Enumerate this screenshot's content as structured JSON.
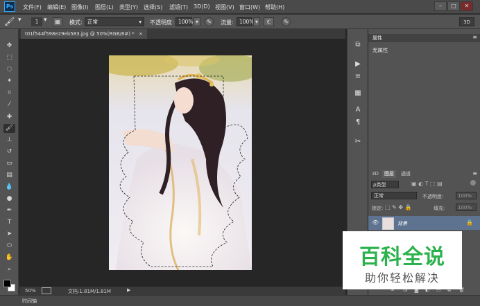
{
  "menubar": {
    "logo": "Ps",
    "items": [
      "文件(F)",
      "编辑(E)",
      "图像(I)",
      "图层(L)",
      "类型(Y)",
      "选择(S)",
      "滤镜(T)",
      "3D(D)",
      "视图(V)",
      "窗口(W)",
      "帮助(H)"
    ],
    "window_controls": [
      "–",
      "□",
      "✕"
    ]
  },
  "options": {
    "mode_label": "模式:",
    "mode_value": "正常",
    "opacity_label": "不透明度:",
    "opacity_value": "100%",
    "flow_label": "流量:",
    "flow_value": "100%",
    "brush_size": "1",
    "workspace_3d": "3D"
  },
  "document": {
    "tab_title": "t01f544f598e29eb583.jpg @ 50%(RGB/8#) *",
    "zoom": "50%",
    "doc_size": "文档:1.81M/1.81M"
  },
  "timeline": {
    "label": "时间轴"
  },
  "properties": {
    "title": "属性",
    "no_props": "无属性"
  },
  "layers": {
    "tabs": [
      "3D",
      "图层",
      "通道"
    ],
    "filter_label": "ρ类型",
    "blend_mode": "正常",
    "opacity_label": "不透明度:",
    "opacity_value": "100%",
    "lock_label": "锁定:",
    "fill_label": "填充:",
    "fill_value": "100%",
    "layer_name": "背景"
  },
  "watermark": {
    "title": "百科全说",
    "subtitle": "助你轻松解决"
  },
  "colors": {
    "accent_blue": "#31a8ff",
    "watermark_green": "#2bb24c",
    "layer_selected": "#5d7390"
  }
}
